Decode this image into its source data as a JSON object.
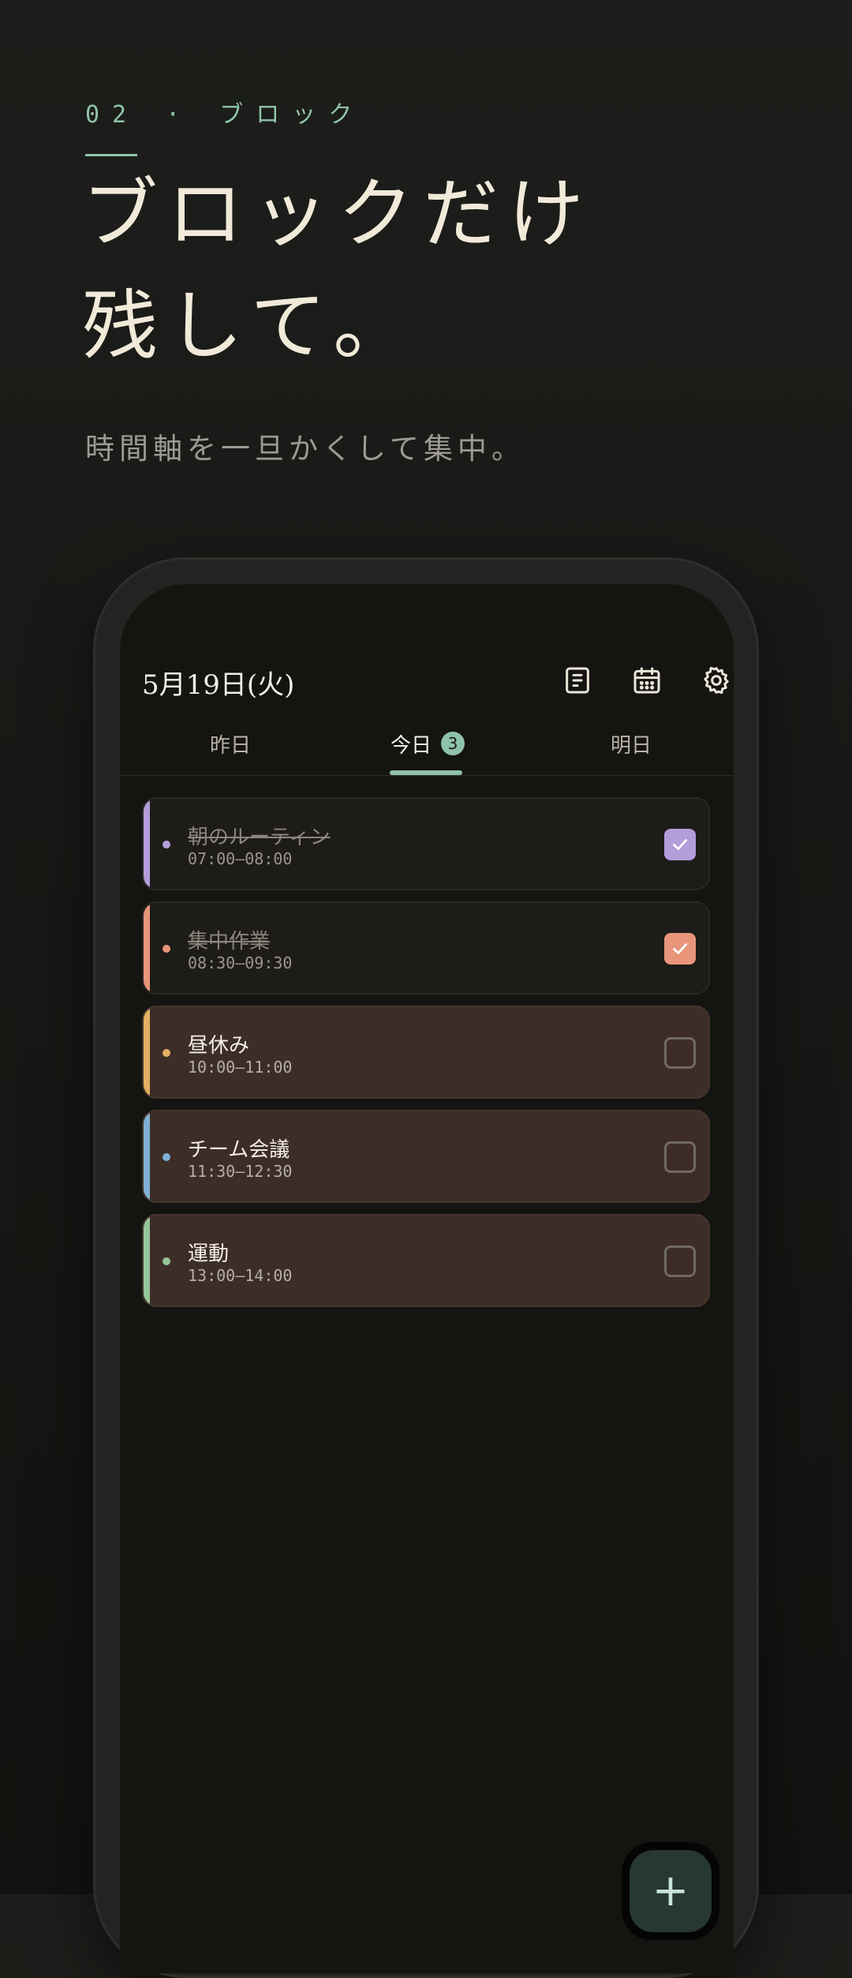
{
  "hero": {
    "eyebrow": "02 · ブロック",
    "title_line1": "ブロックだけ",
    "title_line2": "残して。",
    "subtitle": "時間軸を一旦かくして集中。"
  },
  "app": {
    "date": "5月19日(火)",
    "header_icons": [
      "notes-icon",
      "calendar-icon",
      "gear-icon"
    ],
    "tabs": [
      {
        "label": "昨日"
      },
      {
        "label": "今日",
        "badge": "3",
        "active": true
      },
      {
        "label": "明日"
      }
    ],
    "tasks": [
      {
        "title": "朝のルーティン",
        "time": "07:00–08:00",
        "done": true,
        "color": "#b39ddb"
      },
      {
        "title": "集中作業",
        "time": "08:30–09:30",
        "done": true,
        "color": "#e8957a"
      },
      {
        "title": "昼休み",
        "time": "10:00–11:00",
        "done": false,
        "color": "#e2b063"
      },
      {
        "title": "チーム会議",
        "time": "11:30–12:30",
        "done": false,
        "color": "#7fb0d3"
      },
      {
        "title": "運動",
        "time": "13:00–14:00",
        "done": false,
        "color": "#94c69a"
      }
    ],
    "fab": {
      "symbol": "+"
    }
  },
  "colors": {
    "accent": "#8fc2ad",
    "background": "#171815"
  }
}
